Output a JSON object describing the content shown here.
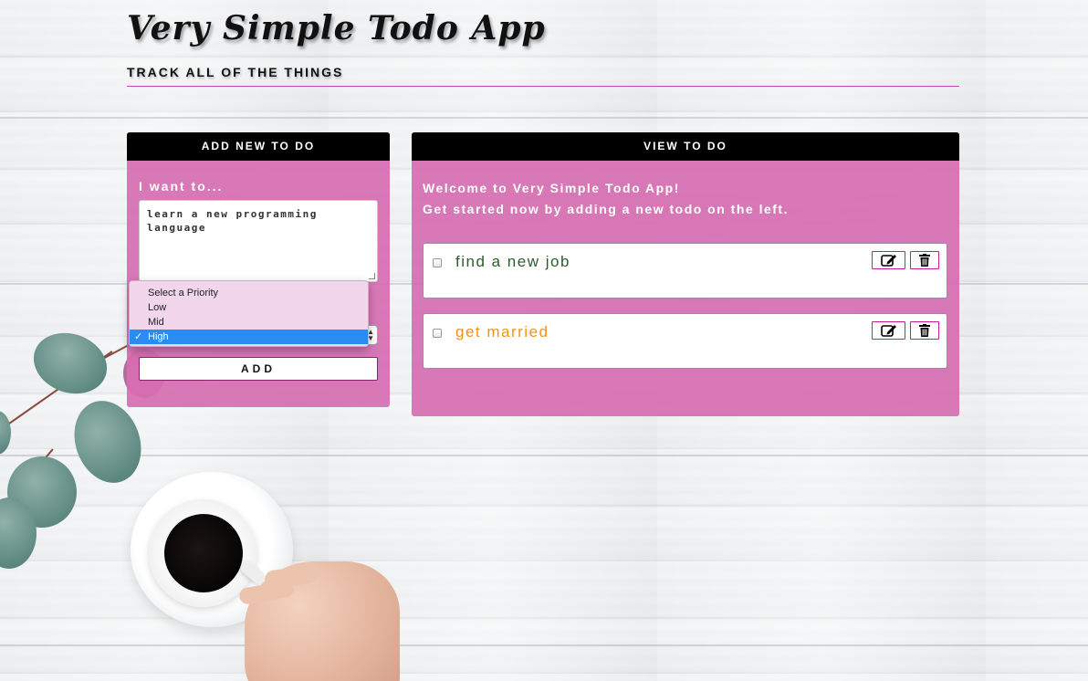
{
  "app": {
    "title": "Very Simple Todo App",
    "subtitle": "TRACK ALL OF THE THINGS"
  },
  "add_panel": {
    "header": "ADD NEW TO DO",
    "label": "I want to...",
    "textarea_value": "learn a new programming language",
    "priority": {
      "placeholder": "Select a Priority",
      "options": [
        "Select a Priority",
        "Low",
        "Mid",
        "High"
      ],
      "selected": "High"
    },
    "add_label": "ADD"
  },
  "view_panel": {
    "header": "VIEW TO DO",
    "welcome_line1": "Welcome to Very Simple Todo App!",
    "welcome_line2": "Get started now by adding a new todo on the left.",
    "todos": [
      {
        "text": "find a new job",
        "color": "#2e5b2e",
        "checked": false
      },
      {
        "text": "get married",
        "color": "#f0921a",
        "checked": false
      }
    ]
  },
  "colors": {
    "panel_bg": "#d66eb2",
    "header_bg": "#000000",
    "accent_border": "#c21f8c",
    "selected_option": "#2a8cf0"
  },
  "icons": {
    "edit": "edit-icon",
    "delete": "trash-icon",
    "check": "checkmark-icon"
  }
}
